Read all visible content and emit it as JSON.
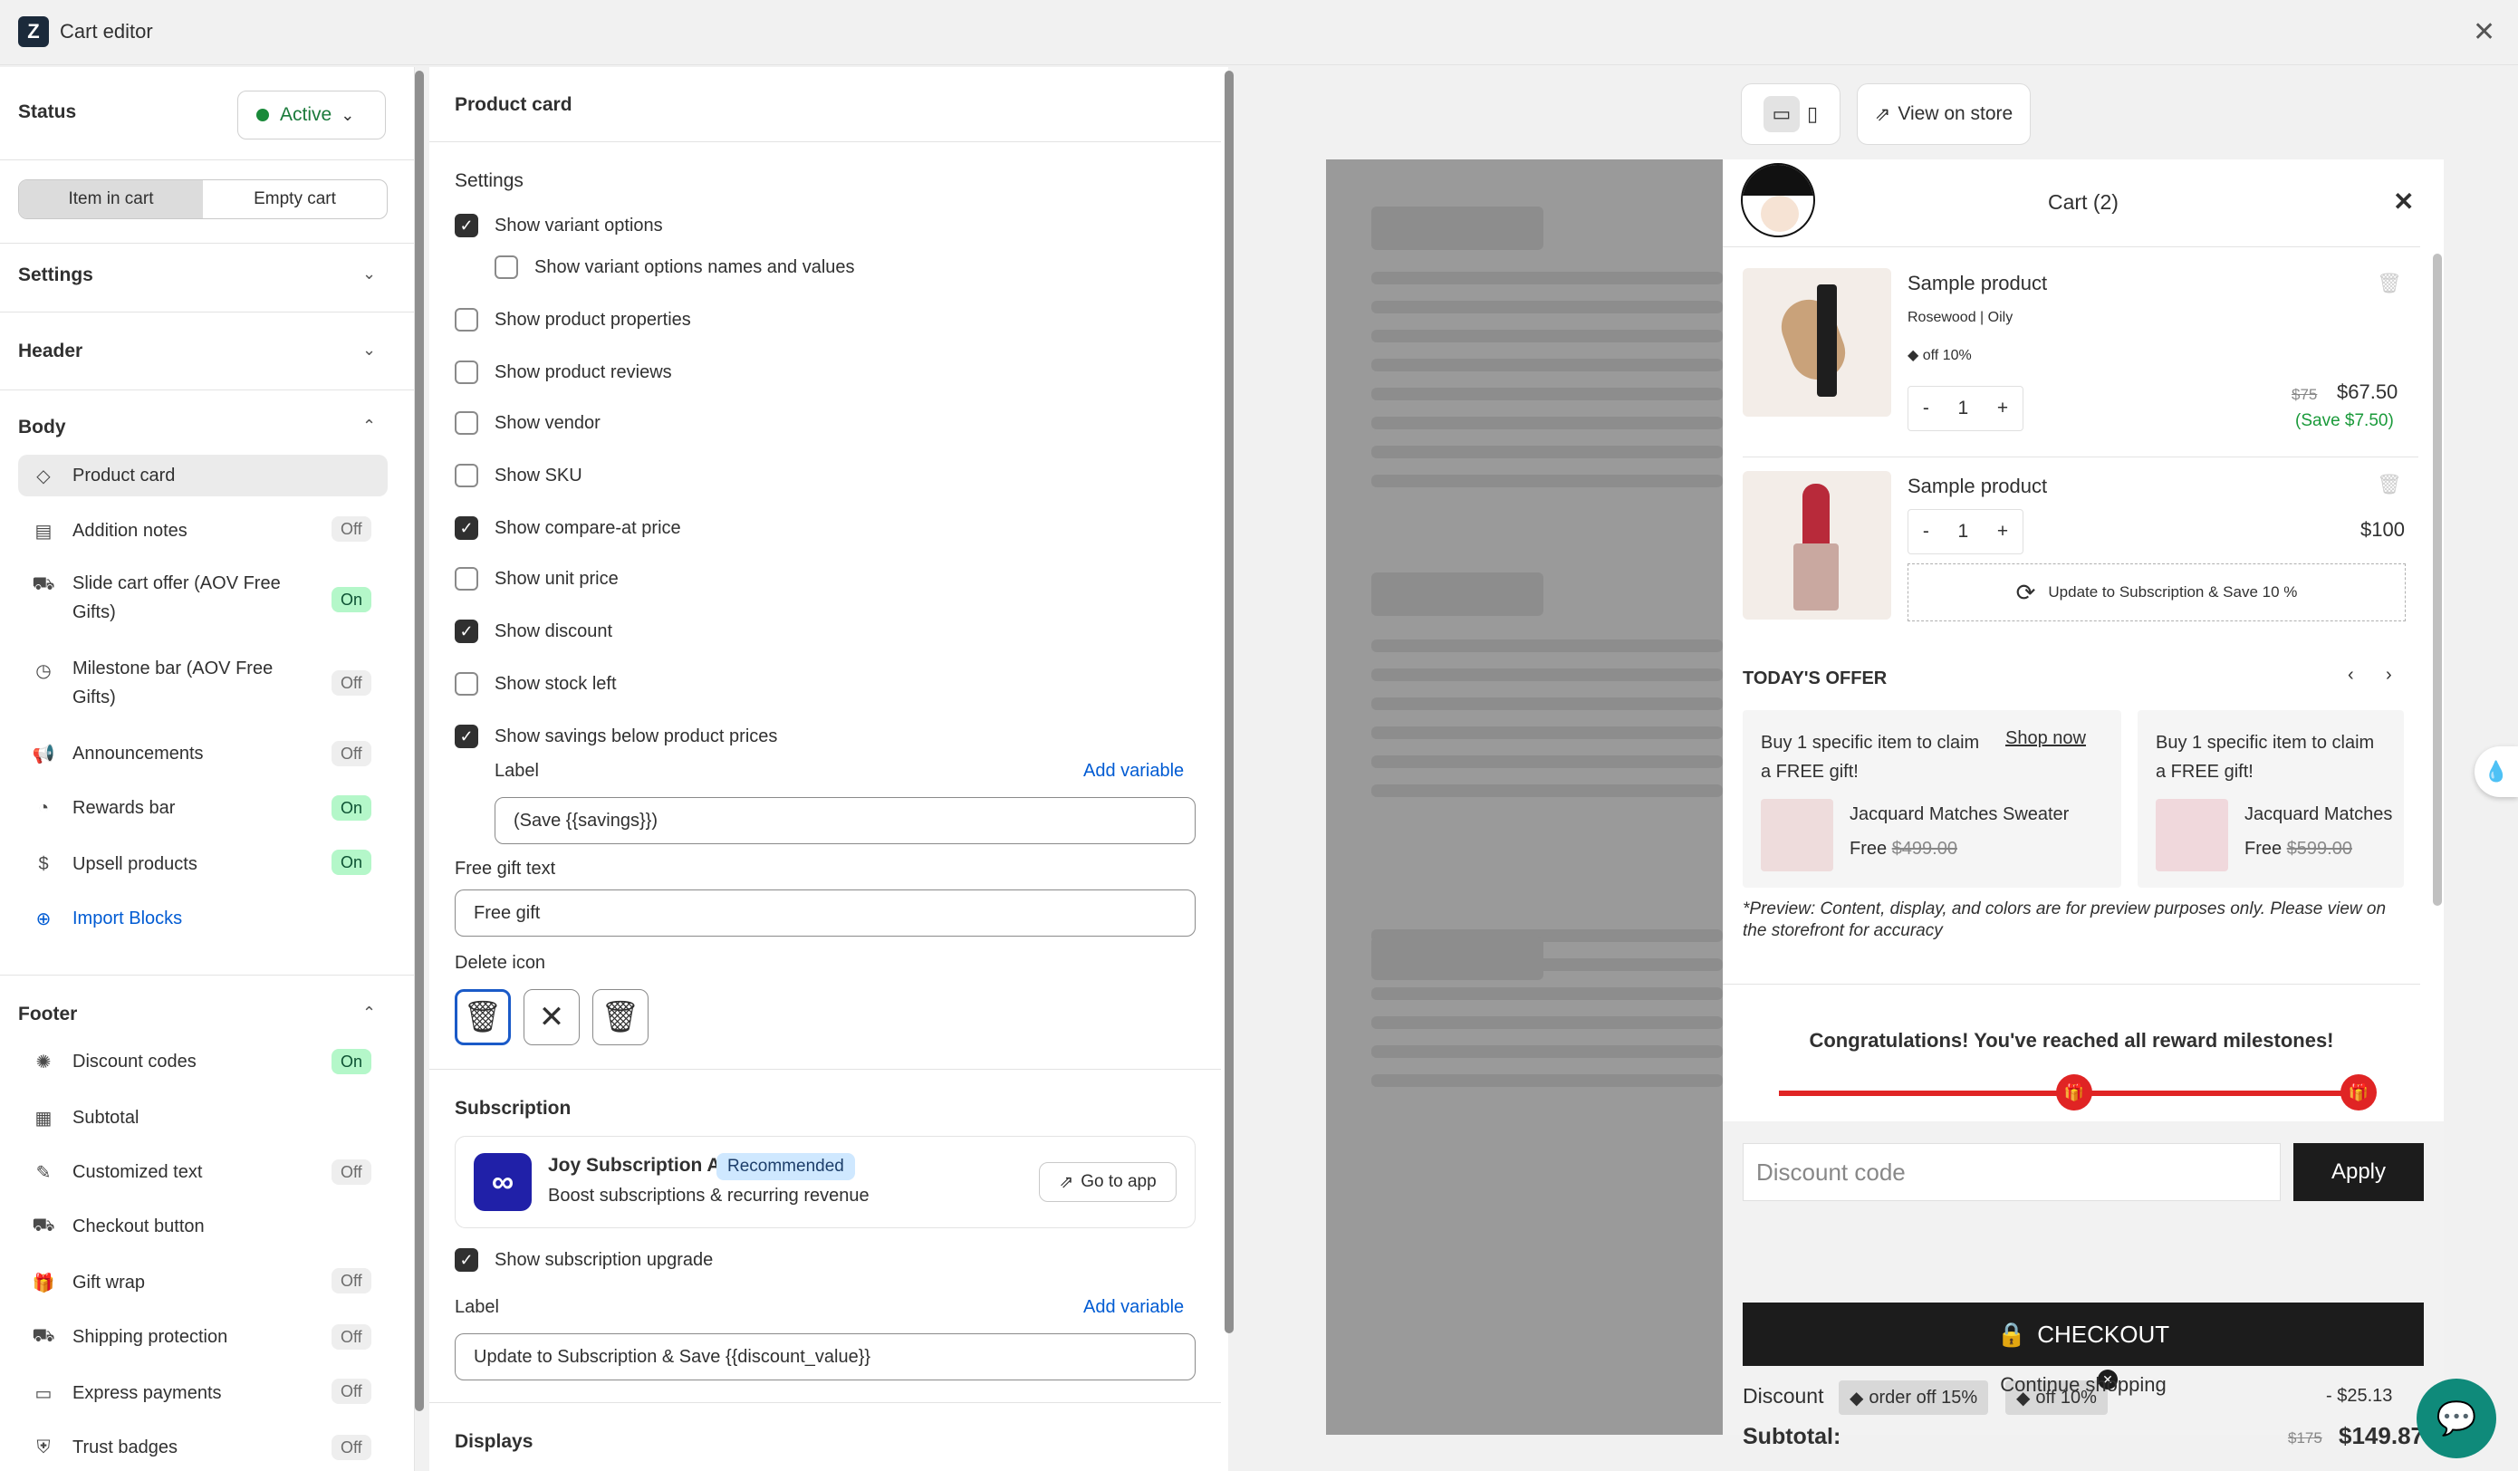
{
  "app": {
    "title": "Cart editor"
  },
  "sidebar": {
    "status_label": "Status",
    "status_value": "Active",
    "tabs": [
      "Item in cart",
      "Empty cart"
    ],
    "settings": "Settings",
    "header": "Header",
    "body": "Body",
    "body_items": [
      {
        "label": "Product card",
        "state": ""
      },
      {
        "label": "Addition notes",
        "state": "Off"
      },
      {
        "label": "Slide cart offer (AOV Free Gifts)",
        "state": "On"
      },
      {
        "label": "Milestone bar (AOV Free Gifts)",
        "state": "Off"
      },
      {
        "label": "Announcements",
        "state": "Off"
      },
      {
        "label": "Rewards bar",
        "state": "On"
      },
      {
        "label": "Upsell products",
        "state": "On"
      }
    ],
    "import_blocks": "Import Blocks",
    "footer": "Footer",
    "footer_items": [
      {
        "label": "Discount codes",
        "state": "On"
      },
      {
        "label": "Subtotal",
        "state": ""
      },
      {
        "label": "Customized text",
        "state": "Off"
      },
      {
        "label": "Checkout button",
        "state": ""
      },
      {
        "label": "Gift wrap",
        "state": "Off"
      },
      {
        "label": "Shipping protection",
        "state": "Off"
      },
      {
        "label": "Express payments",
        "state": "Off"
      },
      {
        "label": "Trust badges",
        "state": "Off"
      }
    ]
  },
  "editor": {
    "title": "Product card",
    "settings_heading": "Settings",
    "options": [
      {
        "label": "Show variant options",
        "checked": true
      },
      {
        "label": "Show variant options names and values",
        "checked": false
      },
      {
        "label": "Show product properties",
        "checked": false
      },
      {
        "label": "Show product reviews",
        "checked": false
      },
      {
        "label": "Show vendor",
        "checked": false
      },
      {
        "label": "Show SKU",
        "checked": false
      },
      {
        "label": "Show compare-at price",
        "checked": true
      },
      {
        "label": "Show unit price",
        "checked": false
      },
      {
        "label": "Show discount",
        "checked": true
      },
      {
        "label": "Show stock left",
        "checked": false
      },
      {
        "label": "Show savings below product prices",
        "checked": true
      }
    ],
    "label_text": "Label",
    "add_variable": "Add variable",
    "savings_value": "(Save {{savings}})",
    "free_gift_label": "Free gift text",
    "free_gift_value": "Free gift",
    "delete_icon_label": "Delete icon",
    "subscription_heading": "Subscription",
    "joy": {
      "name": "Joy Subscription App",
      "badge": "Recommended",
      "desc": "Boost subscriptions & recurring revenue",
      "go": "Go to app"
    },
    "show_sub_upgrade": "Show subscription upgrade",
    "sub_label_value": "Update to Subscription & Save {{discount_value}}",
    "displays_heading": "Displays"
  },
  "preview": {
    "view_on_store": "View on store",
    "cart_title": "Cart (2)",
    "items": [
      {
        "name": "Sample product",
        "variant": "Rosewood | Oily",
        "discount": "off 10%",
        "qty": "1",
        "compare": "$75",
        "price": "$67.50",
        "save": "(Save $7.50)"
      },
      {
        "name": "Sample product",
        "qty": "1",
        "price": "$100",
        "sub_btn": "Update to Subscription & Save 10 %"
      }
    ],
    "offer_title": "TODAY'S OFFER",
    "offers": [
      {
        "text": "Buy 1 specific item to claim a FREE gift!",
        "shop": "Shop now",
        "product": "Jacquard Matches Sweater",
        "free": "Free",
        "was": "$499.00"
      },
      {
        "text": "Buy 1 specific item to claim a FREE gift!",
        "product": "Jacquard Matches",
        "free": "Free",
        "was": "$599.00"
      }
    ],
    "note": "*Preview: Content, display, and colors are for preview purposes only. Please view on the storefront for accuracy",
    "congrats": "Congratulations! You've reached all reward milestones!",
    "progress": 1.0,
    "discount_placeholder": "Discount code",
    "apply": "Apply",
    "discount_label": "Discount",
    "chips": [
      "order off 15%",
      "off 10%"
    ],
    "discount_amount": "- $25.13",
    "subtotal_label": "Subtotal:",
    "subtotal_was": "$175",
    "subtotal": "$149.87",
    "checkout": "CHECKOUT",
    "continue": "Continue shopping",
    "colors": {
      "accent": "#e02424",
      "dark": "#1c1c1c"
    }
  }
}
